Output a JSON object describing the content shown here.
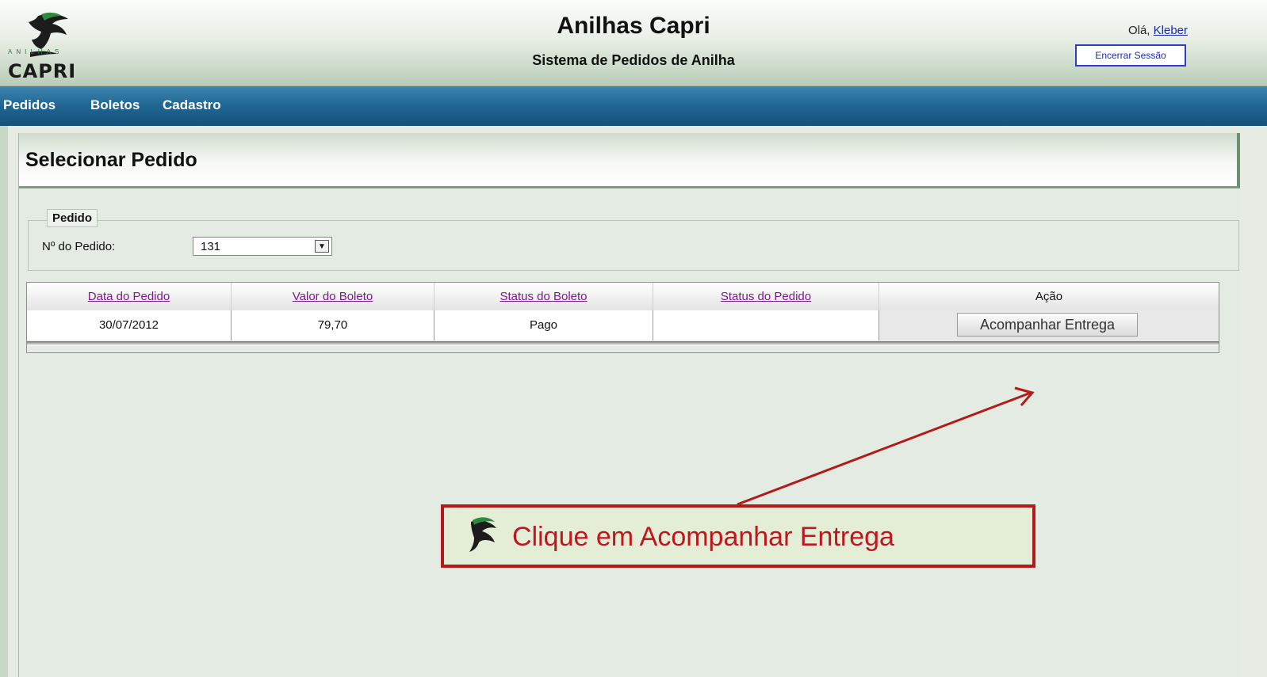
{
  "header": {
    "logo_small": "ANILHAS",
    "logo_text": "CAPRI",
    "title": "Anilhas Capri",
    "subtitle": "Sistema de Pedidos de Anilha",
    "greeting_prefix": "Olá, ",
    "user_name": "Kleber",
    "logout_label": "Encerrar Sessão"
  },
  "nav": {
    "items": [
      "Pedidos",
      "Boletos",
      "Cadastro"
    ]
  },
  "panel": {
    "title": "Selecionar Pedido",
    "fieldset_legend": "Pedido",
    "order_label": "Nº do Pedido:",
    "order_selected": "131"
  },
  "table": {
    "columns": [
      "Data do Pedido",
      "Valor do Boleto",
      "Status do Boleto",
      "Status do Pedido",
      "Ação"
    ],
    "rows": [
      {
        "date": "30/07/2012",
        "value": "79,70",
        "boleto_status": "Pago",
        "order_status": "",
        "action_label": "Acompanhar Entrega"
      }
    ]
  },
  "annotation": {
    "text": "Clique em Acompanhar Entrega",
    "color": "#c0161d"
  },
  "colors": {
    "nav_bg": "#1f6591",
    "link_sort": "#7c1a8c",
    "logout_border": "#2c3ec8"
  }
}
